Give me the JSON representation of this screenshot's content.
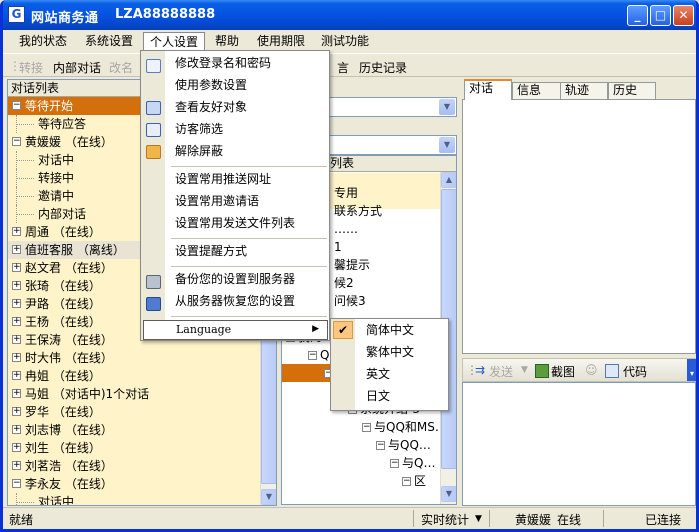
{
  "window": {
    "title": "网站商务通",
    "account": "LZA88888888",
    "minimize": "_",
    "maximize": "□",
    "close": "✕"
  },
  "menubar": [
    "我的状态",
    "系统设置",
    "个人设置",
    "帮助",
    "使用期限",
    "测试功能"
  ],
  "toolbar": {
    "transfer": "转接",
    "internal_chat": "内部对话",
    "rename": "改名",
    "message": "言",
    "history": "历史记录"
  },
  "left_panel": {
    "header": "对话列表",
    "rows": [
      {
        "text": "等待开始",
        "type": "group",
        "sign": "-",
        "style": "selected"
      },
      {
        "text": "等待应答",
        "type": "child"
      },
      {
        "text": "黄媛媛 （在线）",
        "type": "group",
        "sign": "-"
      },
      {
        "text": "对话中",
        "type": "child"
      },
      {
        "text": "转接中",
        "type": "child"
      },
      {
        "text": "邀请中",
        "type": "child"
      },
      {
        "text": "内部对话",
        "type": "child"
      },
      {
        "text": "周通 （在线）",
        "type": "group",
        "sign": "+"
      },
      {
        "text": "值班客服 （离线）",
        "type": "group",
        "sign": "+",
        "style": "grey"
      },
      {
        "text": "赵文君 （在线）",
        "type": "group",
        "sign": "+"
      },
      {
        "text": "张琦 （在线）",
        "type": "group",
        "sign": "+"
      },
      {
        "text": "尹路 （在线）",
        "type": "group",
        "sign": "+"
      },
      {
        "text": "王杨 （在线）",
        "type": "group",
        "sign": "+"
      },
      {
        "text": "王保涛 （在线）",
        "type": "group",
        "sign": "+"
      },
      {
        "text": "时大伟 （在线）",
        "type": "group",
        "sign": "+"
      },
      {
        "text": "冉姐 （在线）",
        "type": "group",
        "sign": "+"
      },
      {
        "text": "马姐 （对话中)1个对话",
        "type": "group",
        "sign": "+"
      },
      {
        "text": "罗华 （在线）",
        "type": "group",
        "sign": "+"
      },
      {
        "text": "刘志博 （在线）",
        "type": "group",
        "sign": "+"
      },
      {
        "text": "刘生 （在线）",
        "type": "group",
        "sign": "+"
      },
      {
        "text": "刘茗浩 （在线）",
        "type": "group",
        "sign": "+"
      },
      {
        "text": "李永友 （在线）",
        "type": "group",
        "sign": "-"
      },
      {
        "text": "对话中",
        "type": "child"
      }
    ]
  },
  "mid_panel": {
    "header": "列表",
    "partial_rows": [
      "专用",
      "联系方式",
      "……",
      "1",
      "馨提示",
      "候2",
      "问候3"
    ],
    "tree_rows": [
      "我的",
      "QQ",
      "",
      "系统介绍-3",
      "与QQ和MS…",
      "与QQ…",
      "与Q…",
      "区"
    ]
  },
  "right_panel": {
    "tabs": [
      "对话",
      "信息",
      "轨迹",
      "历史"
    ],
    "send": "发送",
    "screenshot": "截图",
    "code": "代码"
  },
  "statusbar": {
    "ready": "就绪",
    "realtime_stats": "实时统计",
    "user": "黄媛媛",
    "online": "在线",
    "connected": "已连接"
  },
  "dropdown": {
    "items": [
      "修改登录名和密码",
      "使用参数设置",
      "查看友好对象",
      "访客筛选",
      "解除屏蔽",
      "设置常用推送网址",
      "设置常用邀请语",
      "设置常用发送文件列表",
      "设置提醒方式",
      "备份您的设置到服务器",
      "从服务器恢复您的设置"
    ],
    "language": "Language"
  },
  "submenu": {
    "items": [
      "简体中文",
      "繁体中文",
      "英文",
      "日文"
    ],
    "check": "✔"
  },
  "colors": {
    "title_blue": "#0553E1",
    "selection_orange": "#D4700B",
    "list_background": "#FFF3C9"
  }
}
